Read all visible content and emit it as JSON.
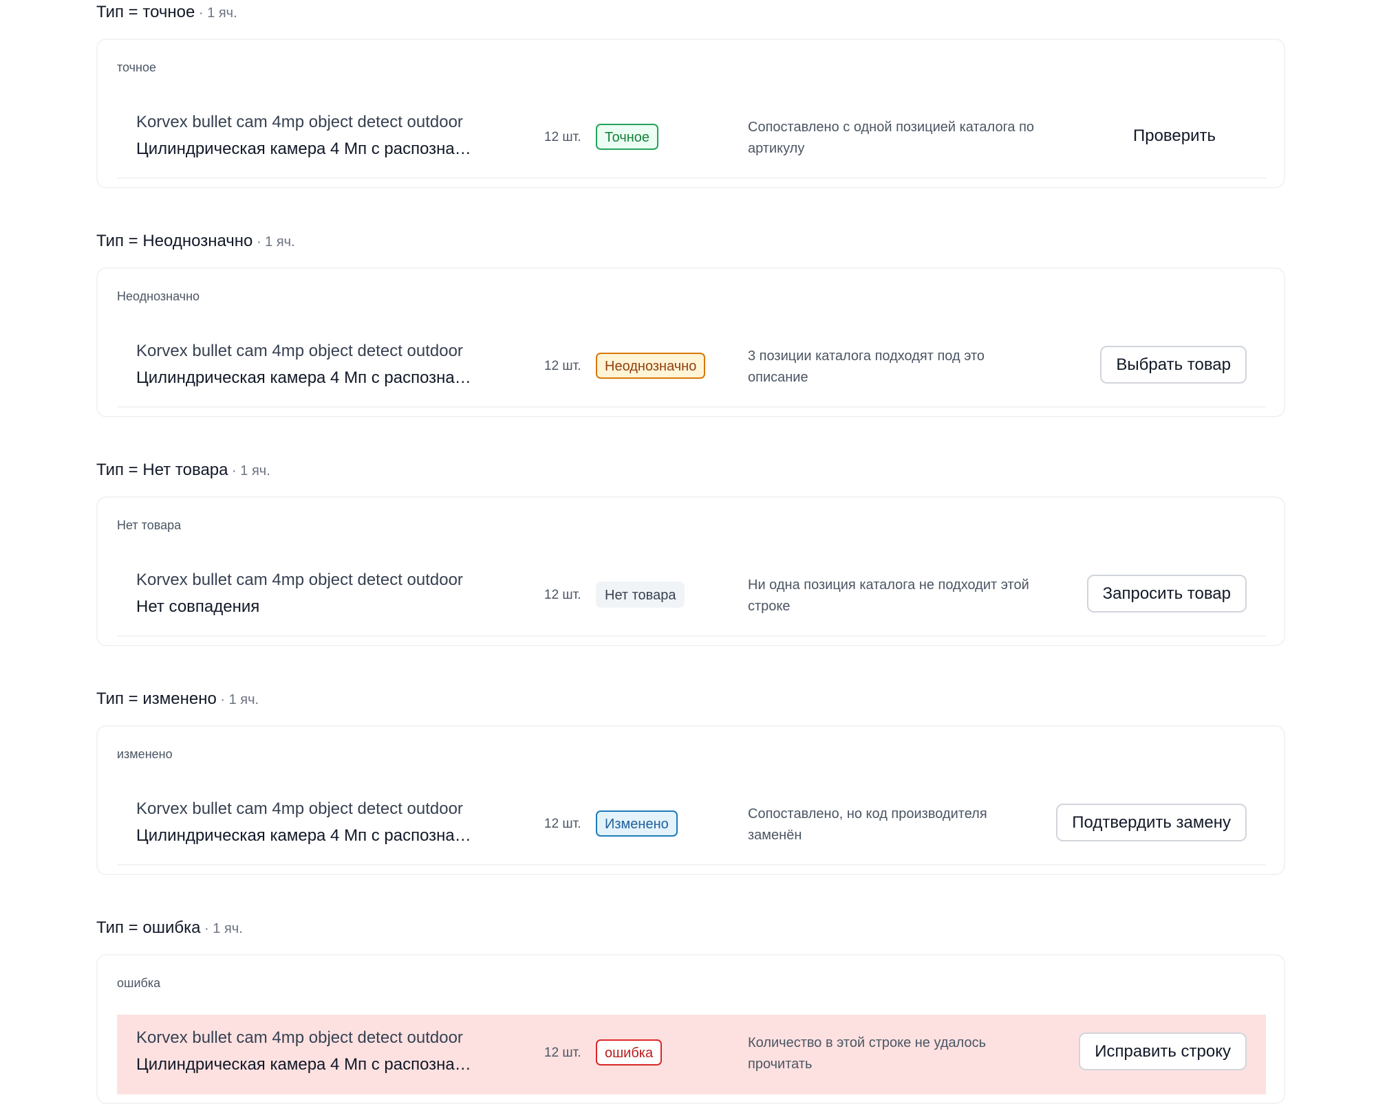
{
  "colors": {
    "exact": {
      "text": "#15803d",
      "bg": "#ecfdf3",
      "border": "#22a35a"
    },
    "ambiguous": {
      "text": "#92400e",
      "bg": "#fff4d6",
      "border": "#d97706"
    },
    "none": {
      "text": "#374151",
      "bg": "#f1f4f7",
      "border": "#f1f4f7"
    },
    "changed": {
      "text": "#1e5f99",
      "bg": "#e3f2fb",
      "border": "#1f7bb7"
    },
    "error": {
      "text": "#b91c1c",
      "bg": "#ffffff",
      "border": "#dc2626"
    },
    "error_row_bg": "#fde1e1"
  },
  "sections": [
    {
      "title": "Тип = точное",
      "count": " · 1 яч.",
      "label": "точное",
      "row": {
        "name1": "Korvex bullet cam 4mp object detect outdoor",
        "name2": "Цилиндрическая камера 4 Мп с распозна…",
        "qty": "12 шт.",
        "badge": "Точное",
        "desc": "Сопоставлено с одной позицией каталога по артикулу",
        "action": "Проверить"
      }
    },
    {
      "title": "Тип = Неоднозначно",
      "count": " · 1 яч.",
      "label": "Неоднозначно",
      "row": {
        "name1": "Korvex bullet cam 4mp object detect outdoor",
        "name2": "Цилиндрическая камера 4 Мп с распозна…",
        "qty": "12 шт.",
        "badge": "Неоднозначно",
        "desc": "3 позиции каталога подходят под это описание",
        "action": "Выбрать товар"
      }
    },
    {
      "title": "Тип = Нет товара",
      "count": " · 1 яч.",
      "label": "Нет товара",
      "row": {
        "name1": "Korvex bullet cam 4mp object detect outdoor",
        "name2": "Нет совпадения",
        "qty": "12 шт.",
        "badge": "Нет товара",
        "desc": "Ни одна позиция каталога не подходит этой строке",
        "action": "Запросить товар"
      }
    },
    {
      "title": "Тип = изменено",
      "count": " · 1 яч.",
      "label": "изменено",
      "row": {
        "name1": "Korvex bullet cam 4mp object detect outdoor",
        "name2": "Цилиндрическая камера 4 Мп с распозна…",
        "qty": "12 шт.",
        "badge": "Изменено",
        "desc": "Сопоставлено, но код производителя заменён",
        "action": "Подтвердить замену"
      }
    },
    {
      "title": "Тип = ошибка",
      "count": " · 1 яч.",
      "label": "ошибка",
      "row": {
        "name1": "Korvex bullet cam 4mp object detect outdoor",
        "name2": "Цилиндрическая камера 4 Мп с распозна…",
        "qty": "12 шт.",
        "badge": "ошибка",
        "desc": "Количество в этой строке не удалось прочитать",
        "action": "Исправить строку"
      }
    }
  ]
}
